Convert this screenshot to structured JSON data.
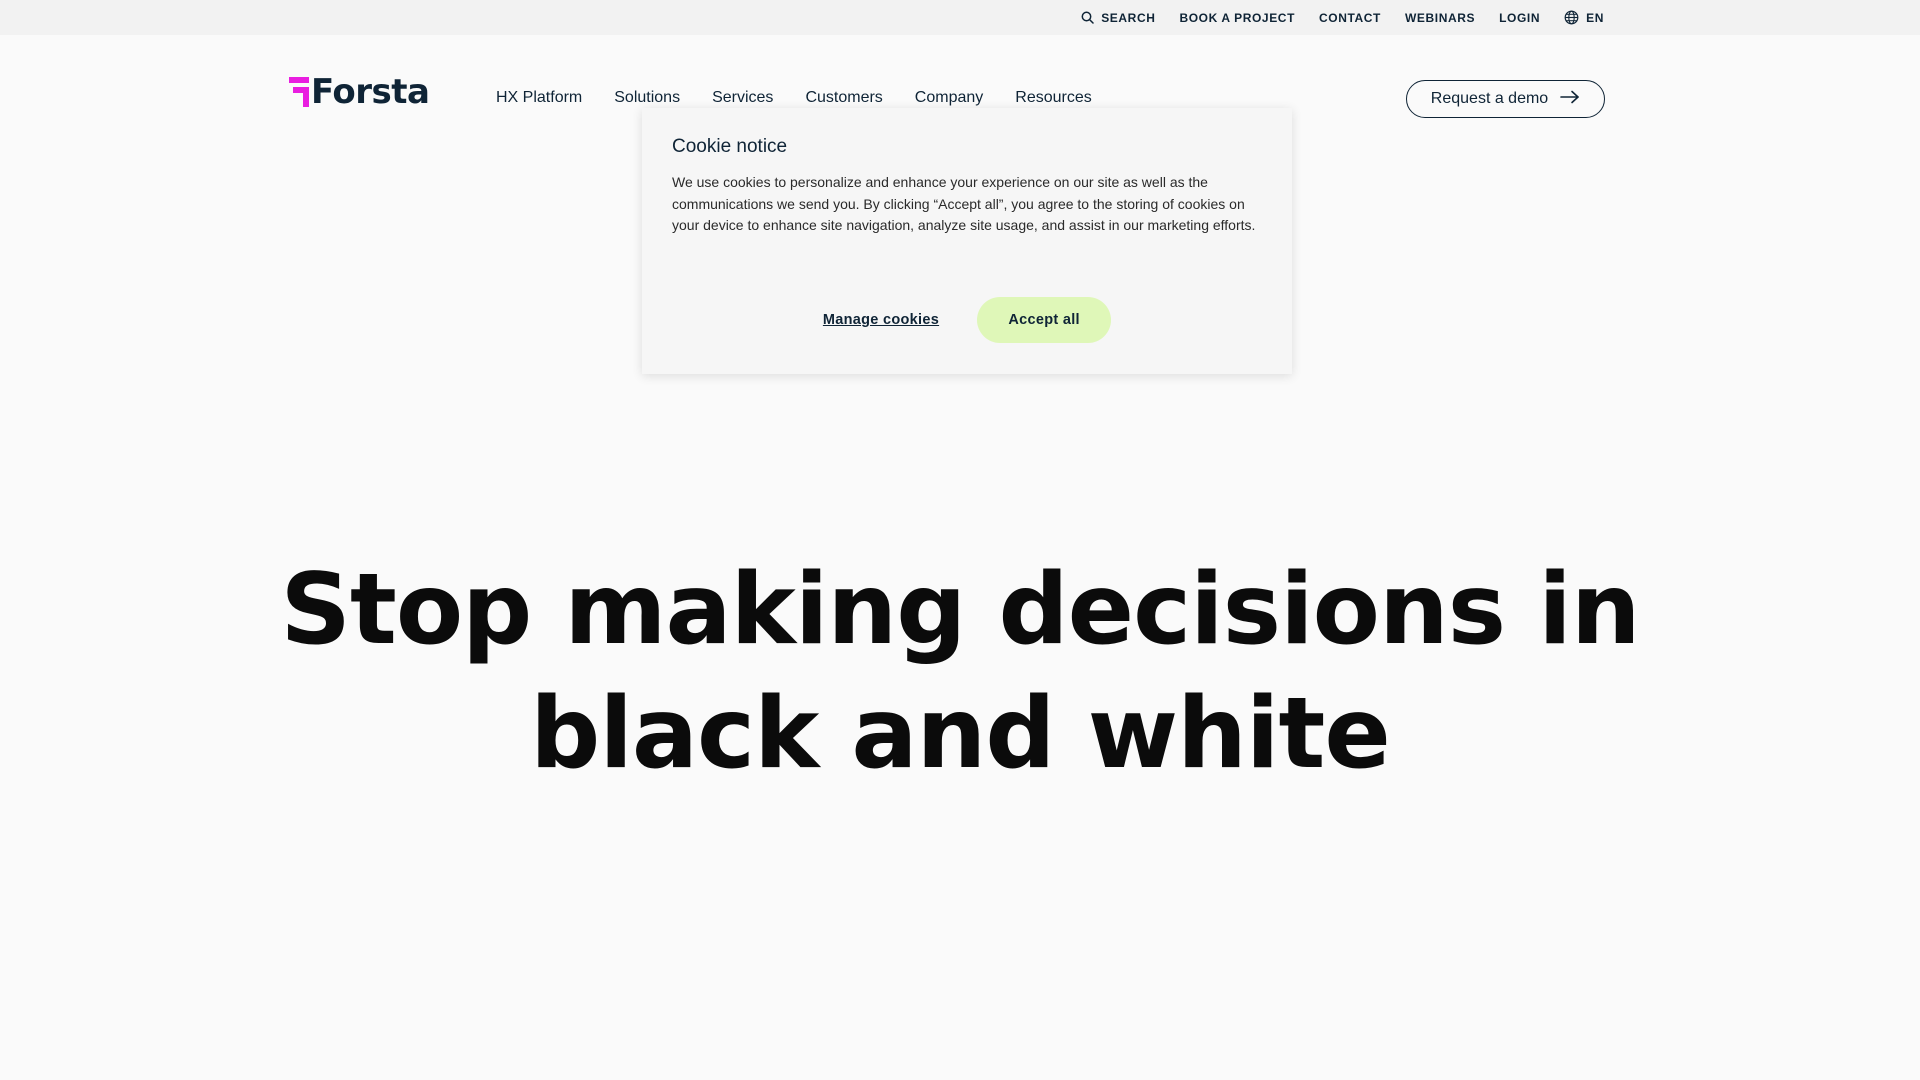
{
  "utility_nav": {
    "search_label": "SEARCH",
    "book_project_label": "BOOK A PROJECT",
    "contact_label": "CONTACT",
    "webinars_label": "WEBINARS",
    "login_label": "LOGIN",
    "language_label": "EN"
  },
  "header": {
    "logo_text": "Forsta",
    "nav_items": [
      "HX Platform",
      "Solutions",
      "Services",
      "Customers",
      "Company",
      "Resources"
    ],
    "demo_button_label": "Request a demo"
  },
  "hero": {
    "title_line1": "Stop making decisions in",
    "title_line2": "black and white"
  },
  "cookie_notice": {
    "title": "Cookie notice",
    "body": "We use cookies to personalize and enhance your experience on our site as well as the communications we send you. By clicking “Accept all”, you agree to the storing of cookies on your device to enhance site navigation, analyze site usage, and assist in our marketing efforts.",
    "manage_label": "Manage cookies",
    "accept_label": "Accept all"
  },
  "colors": {
    "brand_magenta": "#e91ee0",
    "brand_navy": "#0f2436",
    "accept_green": "#dff7b8",
    "utility_bar_bg": "#f2f2f2",
    "page_bg": "#fafafa"
  },
  "icons": {
    "search": "search-icon",
    "globe": "globe-icon",
    "arrow": "arrow-right-icon",
    "logo_mark": "forsta-logo-mark-icon"
  }
}
